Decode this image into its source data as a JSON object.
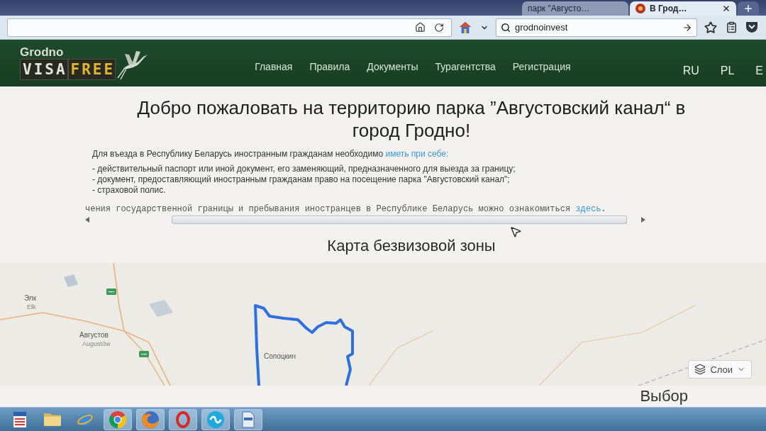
{
  "browser": {
    "tabs": [
      {
        "title": "парк \"Августо…",
        "selected": false
      },
      {
        "title": "В Грод…",
        "selected": true
      }
    ],
    "search": {
      "value": "grodnoinvest"
    }
  },
  "site_header": {
    "logo": {
      "city": "Grodno",
      "word_1": "VISA",
      "word_2": "FREE"
    },
    "nav": [
      {
        "label": "Главная"
      },
      {
        "label": "Правила"
      },
      {
        "label": "Документы"
      },
      {
        "label": "Турагентства"
      },
      {
        "label": "Регистрация"
      }
    ],
    "languages": [
      {
        "label": "RU"
      },
      {
        "label": "PL"
      },
      {
        "label": "E"
      }
    ]
  },
  "intro": {
    "title": "Добро пожаловать на территорию парка ”Августовский канал“ в город Гродно!",
    "lead": "Для въезда в Республику Беларусь иностранным гражданам необходимо",
    "lead_link": "иметь при себе:",
    "requirements": [
      "- действительный паспорт или иной документ, его заменяющий, предназначенного для выезда за границу;",
      "- документ, предоставляющий иностранным гражданам право на посещение парка \"Августовский канал\";",
      "- страховой полис."
    ],
    "note": "чения государственной границы и пребывания иностранцев в Республике Беларусь можно ознакомиться",
    "note_link": "здесь",
    "note_end": "."
  },
  "map_section": {
    "title": "Карта безвизовой зоны",
    "places": [
      {
        "name": "Элк",
        "name_local": "Ełk"
      },
      {
        "name": "Августов",
        "name_local": "Augustów"
      },
      {
        "name": "Сопоцкин"
      }
    ],
    "layers_button": "Слои"
  },
  "next_section": {
    "title": "Выбор"
  },
  "taskbar": {
    "apps": [
      {
        "kind": "stripes",
        "running": false
      },
      {
        "kind": "folder",
        "running": false
      },
      {
        "kind": "globe-ring",
        "running": false
      },
      {
        "kind": "segments",
        "running": true
      },
      {
        "kind": "swirl",
        "running": true
      },
      {
        "kind": "ring",
        "running": true
      },
      {
        "kind": "wave",
        "running": true
      },
      {
        "kind": "document",
        "running": true
      }
    ]
  }
}
